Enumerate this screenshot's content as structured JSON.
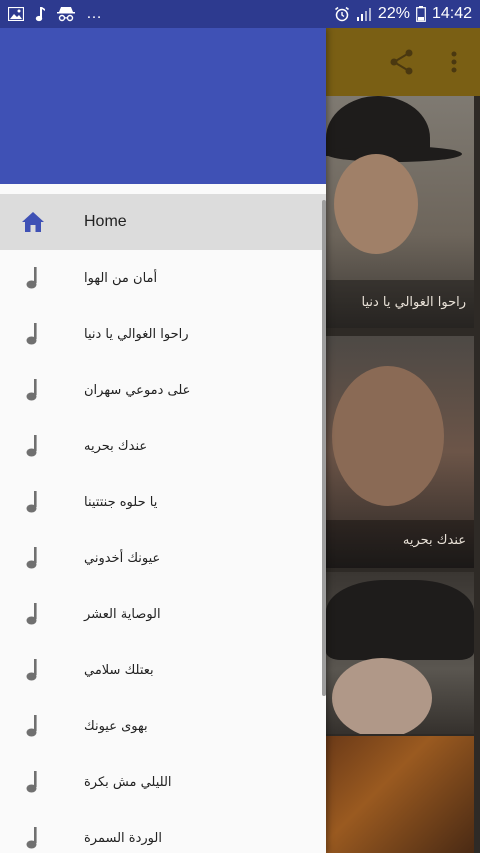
{
  "status_bar": {
    "left_icons": [
      "image-icon",
      "music-note-icon",
      "incognito-icon"
    ],
    "ellipsis": "…",
    "right_icons": [
      "alarm-icon",
      "signal-icon"
    ],
    "battery_percent": "22%",
    "time": "14:42"
  },
  "toolbar": {
    "icons": [
      "share-icon",
      "more-vert-icon"
    ],
    "color": "#7a5f14"
  },
  "background_cards": [
    {
      "caption": "راحوا الغوالي يا دنيا"
    },
    {
      "caption": "عندك بحريه"
    },
    {
      "caption": ""
    },
    {
      "caption": ""
    }
  ],
  "drawer": {
    "header_color": "#3f51b5",
    "home": {
      "label": "Home",
      "icon": "home-icon"
    },
    "items": [
      {
        "label": "أمان من الهوا",
        "icon": "music-note-icon"
      },
      {
        "label": "راحوا الغوالي يا دنيا",
        "icon": "music-note-icon"
      },
      {
        "label": "على دموعي سهران",
        "icon": "music-note-icon"
      },
      {
        "label": "عندك بحريه",
        "icon": "music-note-icon"
      },
      {
        "label": "يا حلوه جنتتينا",
        "icon": "music-note-icon"
      },
      {
        "label": "عيونك أخدوني",
        "icon": "music-note-icon"
      },
      {
        "label": "الوصاية العشر",
        "icon": "music-note-icon"
      },
      {
        "label": "بعتلك سلامي",
        "icon": "music-note-icon"
      },
      {
        "label": "بهوى عيونك",
        "icon": "music-note-icon"
      },
      {
        "label": "الليلي مش بكرة",
        "icon": "music-note-icon"
      },
      {
        "label": "الوردة السمرة",
        "icon": "music-note-icon"
      }
    ]
  }
}
